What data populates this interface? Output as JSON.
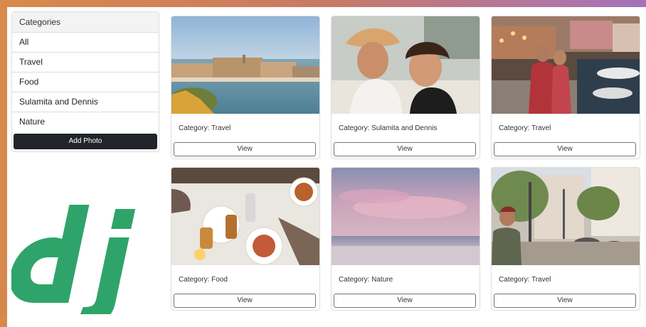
{
  "sidebar": {
    "header": "Categories",
    "items": [
      {
        "label": "All"
      },
      {
        "label": "Travel"
      },
      {
        "label": "Food"
      },
      {
        "label": "Sulamita and Dennis"
      },
      {
        "label": "Nature"
      }
    ],
    "add_button_label": "Add Photo"
  },
  "logo": {
    "text": "dj",
    "color": "#2fa46a"
  },
  "photos": [
    {
      "category": "Category: Travel",
      "view_label": "View",
      "image": "harbor-town-photo"
    },
    {
      "category": "Category: Sulamita and Dennis",
      "view_label": "View",
      "image": "couple-photo"
    },
    {
      "category": "Category: Travel",
      "view_label": "View",
      "image": "waterfront-couple-photo"
    },
    {
      "category": "Category: Food",
      "view_label": "View",
      "image": "dinner-table-photo"
    },
    {
      "category": "Category: Nature",
      "view_label": "View",
      "image": "pink-sky-sea-photo"
    },
    {
      "category": "Category: Travel",
      "view_label": "View",
      "image": "street-photo"
    }
  ],
  "colors": {
    "accent_dark": "#212529",
    "border": "#dcdcdc",
    "outline_button": "#6c757d"
  }
}
